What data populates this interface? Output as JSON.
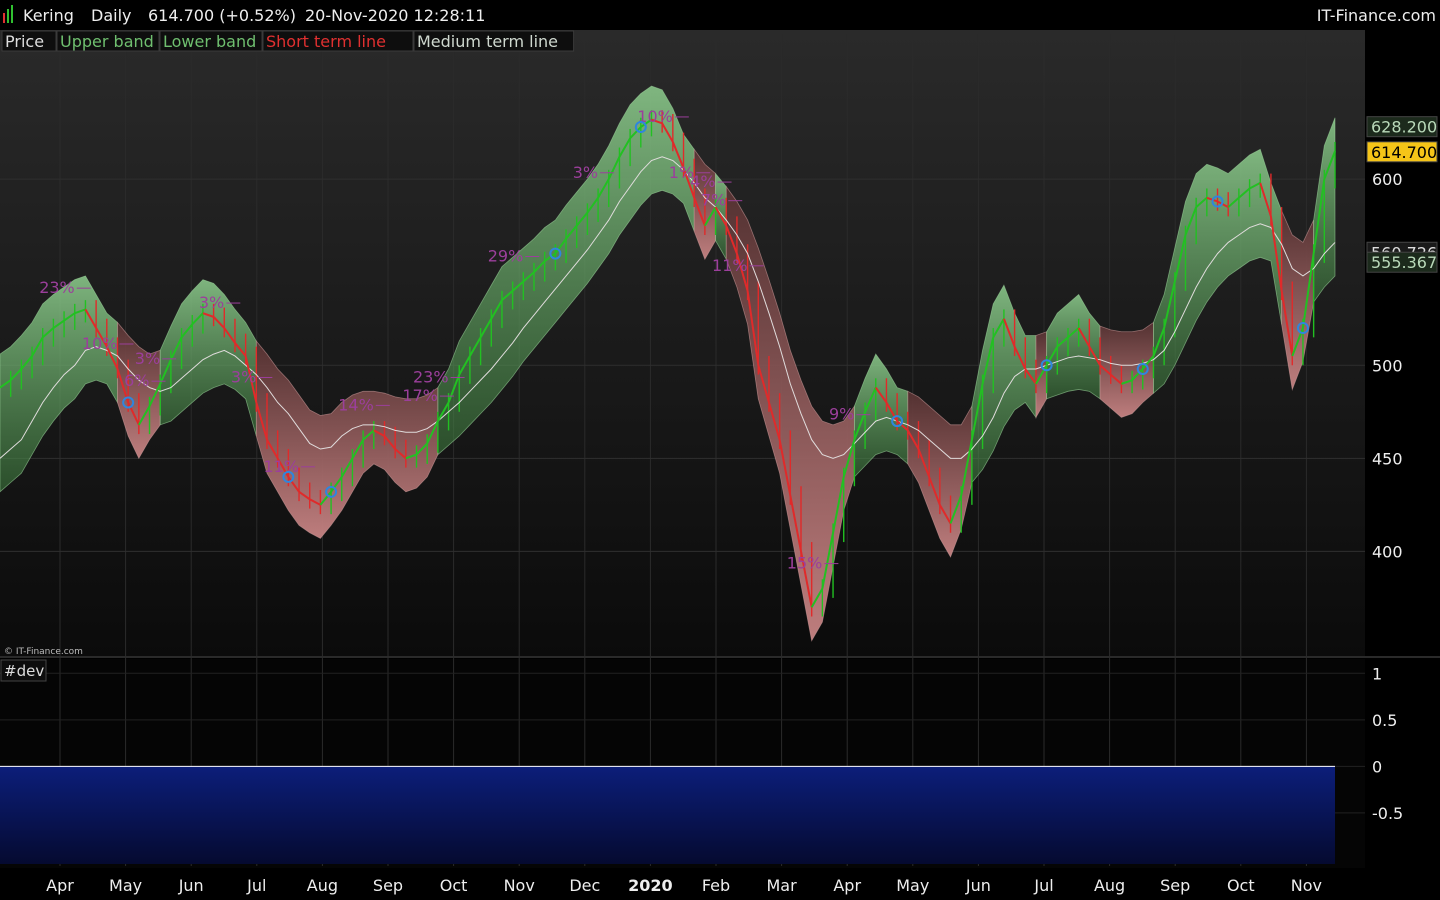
{
  "header": {
    "symbol": "Kering",
    "timeframe": "Daily",
    "last_price": "614.700 (+0.52%)",
    "datetime": "20-Nov-2020 12:28:11",
    "brand": "IT-Finance.com"
  },
  "legend": [
    {
      "label": "Price",
      "color": "#dddddd"
    },
    {
      "label": "Upper band",
      "color": "#6fbf6f"
    },
    {
      "label": "Lower band",
      "color": "#6fbf6f"
    },
    {
      "label": "Short term line",
      "color": "#e03030"
    },
    {
      "label": "Medium term line",
      "color": "#cfd8cf"
    }
  ],
  "copyright": "© IT-Finance.com",
  "price_labels": [
    {
      "text": "628.200",
      "value": 628.2,
      "bg": "#1c2a1c",
      "fg": "#b9d9b9"
    },
    {
      "text": "614.700",
      "value": 614.7,
      "bg": "#f5c518",
      "fg": "#000000"
    },
    {
      "text": "560.726",
      "value": 560.726,
      "bg": "#1a1a1a",
      "fg": "#dddddd"
    },
    {
      "text": "555.367",
      "value": 555.367,
      "bg": "#1c2a1c",
      "fg": "#b9d9b9"
    }
  ],
  "indicator": {
    "name": "#dev"
  },
  "colors": {
    "bull_band": "#7bbf7b",
    "bear_band": "#a86a6a",
    "short_up": "#22c022",
    "short_down": "#e02a2a",
    "medium": "#e0dcdc",
    "annotation": "#9b3f9b",
    "signal": "#2e86de",
    "dev_fill": "#0a1a6a"
  },
  "chart_data": [
    {
      "type": "area",
      "x_ticks": [
        "Apr",
        "May",
        "Jun",
        "Jul",
        "Aug",
        "Sep",
        "Oct",
        "Nov",
        "Dec",
        "2020",
        "Feb",
        "Mar",
        "Apr",
        "May",
        "Jun",
        "Jul",
        "Aug",
        "Sep",
        "Oct",
        "Nov"
      ],
      "y_ticks": [
        400,
        450,
        500,
        600
      ],
      "ylim": [
        347,
        678
      ],
      "series": [
        {
          "name": "Short term line",
          "values": [
            488,
            492,
            498,
            505,
            515,
            520,
            524,
            528,
            530,
            520,
            510,
            498,
            480,
            468,
            478,
            490,
            503,
            515,
            522,
            528,
            526,
            520,
            512,
            505,
            480,
            460,
            450,
            440,
            432,
            428,
            425,
            432,
            440,
            450,
            460,
            465,
            462,
            455,
            450,
            452,
            458,
            470,
            480,
            495,
            505,
            515,
            525,
            535,
            540,
            545,
            550,
            556,
            560,
            568,
            575,
            582,
            590,
            600,
            612,
            622,
            628,
            632,
            630,
            620,
            606,
            590,
            575,
            585,
            575,
            560,
            540,
            500,
            480,
            460,
            430,
            400,
            370,
            380,
            410,
            440,
            460,
            475,
            488,
            480,
            470,
            465,
            455,
            440,
            425,
            415,
            430,
            460,
            490,
            515,
            525,
            510,
            498,
            490,
            500,
            510,
            515,
            520,
            510,
            500,
            495,
            490,
            492,
            498,
            505,
            520,
            545,
            570,
            585,
            590,
            588,
            585,
            590,
            595,
            598,
            580,
            540,
            505,
            520,
            560,
            600,
            615
          ]
        },
        {
          "name": "Medium term line",
          "values": [
            450,
            455,
            460,
            470,
            480,
            488,
            495,
            500,
            508,
            510,
            508,
            505,
            498,
            492,
            488,
            486,
            488,
            493,
            498,
            503,
            506,
            508,
            505,
            500,
            495,
            488,
            480,
            474,
            466,
            458,
            455,
            456,
            462,
            466,
            468,
            468,
            467,
            465,
            464,
            464,
            466,
            470,
            475,
            480,
            486,
            492,
            498,
            505,
            512,
            520,
            527,
            534,
            541,
            548,
            555,
            562,
            570,
            578,
            588,
            596,
            604,
            610,
            612,
            610,
            605,
            598,
            590,
            585,
            578,
            570,
            560,
            545,
            528,
            510,
            490,
            474,
            460,
            452,
            450,
            452,
            458,
            464,
            470,
            472,
            470,
            468,
            465,
            460,
            455,
            450,
            450,
            455,
            462,
            472,
            485,
            494,
            498,
            498,
            500,
            502,
            504,
            505,
            504,
            503,
            501,
            500,
            500,
            501,
            503,
            508,
            518,
            530,
            542,
            552,
            560,
            566,
            570,
            574,
            576,
            574,
            565,
            552,
            548,
            552,
            560,
            566
          ]
        }
      ],
      "signals_pct": [
        "23%",
        "10%",
        "6%",
        "3%",
        "3%",
        "3%",
        "11%",
        "14%",
        "17%",
        "23%",
        "29%",
        "3%",
        "10%",
        "1%",
        "4%",
        "7%",
        "11%",
        "15%",
        "9%"
      ]
    },
    {
      "type": "area",
      "name": "#dev",
      "y_ticks": [
        1,
        0.5,
        0,
        -0.5
      ],
      "ylim": [
        -1.05,
        1.1
      ],
      "series": [
        {
          "name": "#dev",
          "values": [
            -1,
            -1,
            -1,
            -1,
            -1,
            -1,
            -1,
            -1,
            -1,
            -1,
            -1,
            -1,
            -1,
            -1,
            -1,
            -1,
            -1,
            -1,
            -1,
            -1,
            -1,
            -1,
            -1,
            -1,
            -1,
            -1,
            -1,
            -1,
            -1,
            -1,
            -1,
            -1,
            -1,
            -1,
            -1,
            -1,
            -1,
            -1,
            -1,
            -1,
            -1,
            -1,
            -1,
            -1,
            -1,
            -1,
            -1,
            -1,
            -1,
            -1,
            -1,
            -1,
            -1,
            -1,
            -1,
            -1,
            -1,
            -1,
            -1,
            -1,
            -1,
            -1,
            -1,
            -1,
            -1,
            -1,
            -1,
            -1,
            -1,
            -1,
            -1,
            -1,
            -1,
            -1,
            -1,
            -1,
            -1,
            -1,
            -1,
            -1,
            -1,
            -1,
            -1,
            -1,
            -1,
            -1,
            -1,
            -1,
            -1,
            -1,
            -1,
            -1,
            -1,
            -1,
            -1,
            -1,
            -1,
            -1,
            -1,
            -1,
            -1,
            -1,
            -1,
            -1,
            -1,
            -1,
            -1,
            -1,
            -1,
            -1,
            -1,
            -1,
            -1,
            -1,
            -1,
            -1,
            -1,
            -1,
            -1,
            -1,
            -1,
            -1,
            -1,
            -1,
            -1,
            -1
          ]
        }
      ]
    }
  ]
}
